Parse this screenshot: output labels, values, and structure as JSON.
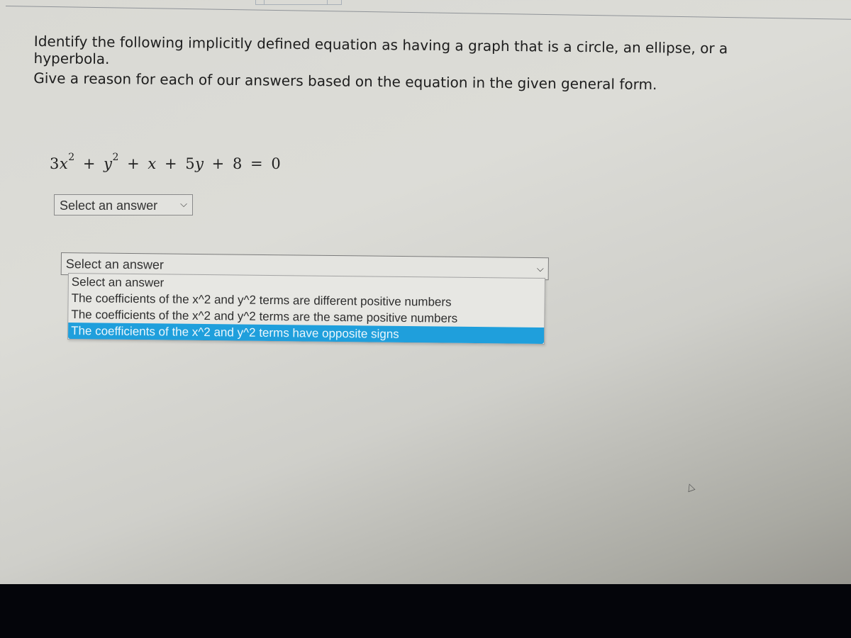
{
  "question": {
    "line1": "Identify the following implicitly defined equation as having a graph that is a circle, an ellipse, or a",
    "line1b": "hyperbola.",
    "line2": "Give a reason for each of our answers based on the equation in the given general form."
  },
  "equation": {
    "t1_coef": "3",
    "t1_var": "x",
    "t1_exp": "2",
    "plus1": "+",
    "t2_var": "y",
    "t2_exp": "2",
    "plus2": "+",
    "t3_var": "x",
    "plus3": "+",
    "t4_coef": "5",
    "t4_var": "y",
    "plus4": "+",
    "const": "8",
    "equals": "=",
    "rhs": "0"
  },
  "shape_select": {
    "value": "Select an answer",
    "chevron": "chevron-down-icon"
  },
  "reason_select": {
    "value": "Select an answer",
    "chevron": "chevron-down-icon",
    "options": [
      "Select an answer",
      "The coefficients of the x^2 and y^2 terms are different positive numbers",
      "The coefficients of the x^2 and y^2 terms are the same positive numbers",
      "The coefficients of the x^2 and y^2 terms have opposite signs"
    ],
    "highlighted_index": 3,
    "highlight_color": "#1f9fdc"
  }
}
